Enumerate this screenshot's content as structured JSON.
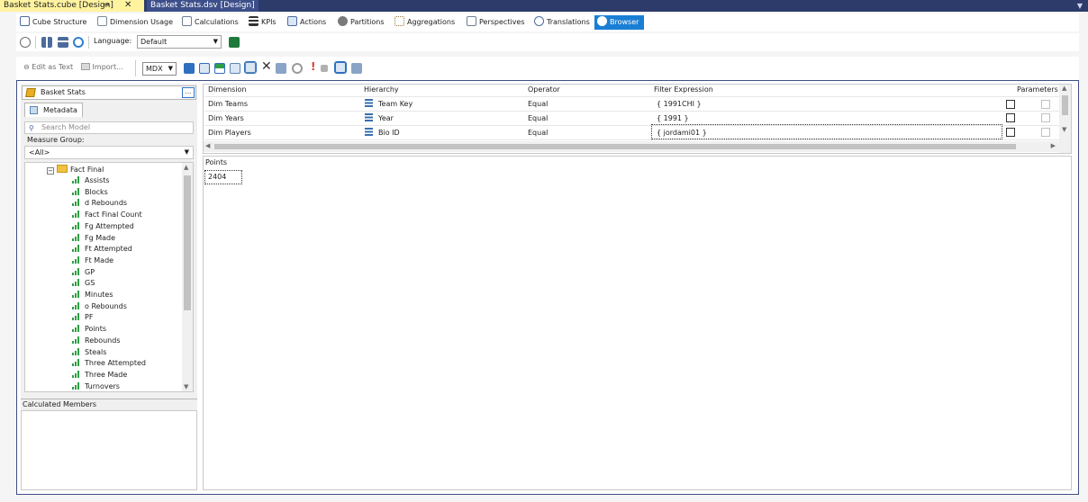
{
  "document_tabs": [
    {
      "label": "Basket Stats.cube [Design]",
      "active": true
    },
    {
      "label": "Basket Stats.dsv [Design]",
      "active": false
    }
  ],
  "designer_tabs": [
    {
      "label": "Cube Structure",
      "icon": "cube-structure-icon",
      "color": "#5a7fb5"
    },
    {
      "label": "Dimension Usage",
      "icon": "dimension-usage-icon",
      "color": "#7a8a9a"
    },
    {
      "label": "Calculations",
      "icon": "calculations-icon",
      "color": "#6d7f94"
    },
    {
      "label": "KPIs",
      "icon": "kpi-icon",
      "color": "#333333"
    },
    {
      "label": "Actions",
      "icon": "actions-icon",
      "color": "#4c6b9c"
    },
    {
      "label": "Partitions",
      "icon": "partitions-icon",
      "color": "#7a7a7a"
    },
    {
      "label": "Aggregations",
      "icon": "aggregations-icon",
      "color": "#9a7a3a"
    },
    {
      "label": "Perspectives",
      "icon": "perspectives-icon",
      "color": "#6d7f94"
    },
    {
      "label": "Translations",
      "icon": "translations-icon",
      "color": "#4c6b9c"
    },
    {
      "label": "Browser",
      "icon": "browser-icon",
      "color": "#ffffff",
      "active": true
    }
  ],
  "toolbar1": {
    "language_label": "Language:",
    "language_value": "Default"
  },
  "toolbar2": {
    "edit_as_text": "Edit as Text",
    "import": "Import...",
    "query_mode": "MDX"
  },
  "left_panel": {
    "cube_name": "Basket Stats",
    "cube_button": "...",
    "metadata_tab": "Metadata",
    "search_placeholder": "Search Model",
    "measure_group_label": "Measure Group:",
    "measure_group_value": "<All>",
    "tree_root": "Fact Final",
    "measures": [
      "Assists",
      "Blocks",
      "d Rebounds",
      "Fact Final Count",
      "Fg Attempted",
      "Fg Made",
      "Ft Attempted",
      "Ft Made",
      "GP",
      "GS",
      "Minutes",
      "o Rebounds",
      "PF",
      "Points",
      "Rebounds",
      "Steals",
      "Three Attempted",
      "Three Made",
      "Turnovers"
    ],
    "calculated_members_label": "Calculated Members"
  },
  "filter_grid": {
    "headers": {
      "dimension": "Dimension",
      "hierarchy": "Hierarchy",
      "operator": "Operator",
      "filter_expression": "Filter Expression",
      "parameters": "Parameters"
    },
    "rows": [
      {
        "dimension": "Dim Teams",
        "hierarchy": "Team Key",
        "operator": "Equal",
        "filter_expression": "{ 1991CHI }"
      },
      {
        "dimension": "Dim Years",
        "hierarchy": "Year",
        "operator": "Equal",
        "filter_expression": "{ 1991 }"
      },
      {
        "dimension": "Dim Players",
        "hierarchy": "Bio ID",
        "operator": "Equal",
        "filter_expression": "{ jordami01 }"
      }
    ]
  },
  "results": {
    "column_header": "Points",
    "value": "2404"
  }
}
